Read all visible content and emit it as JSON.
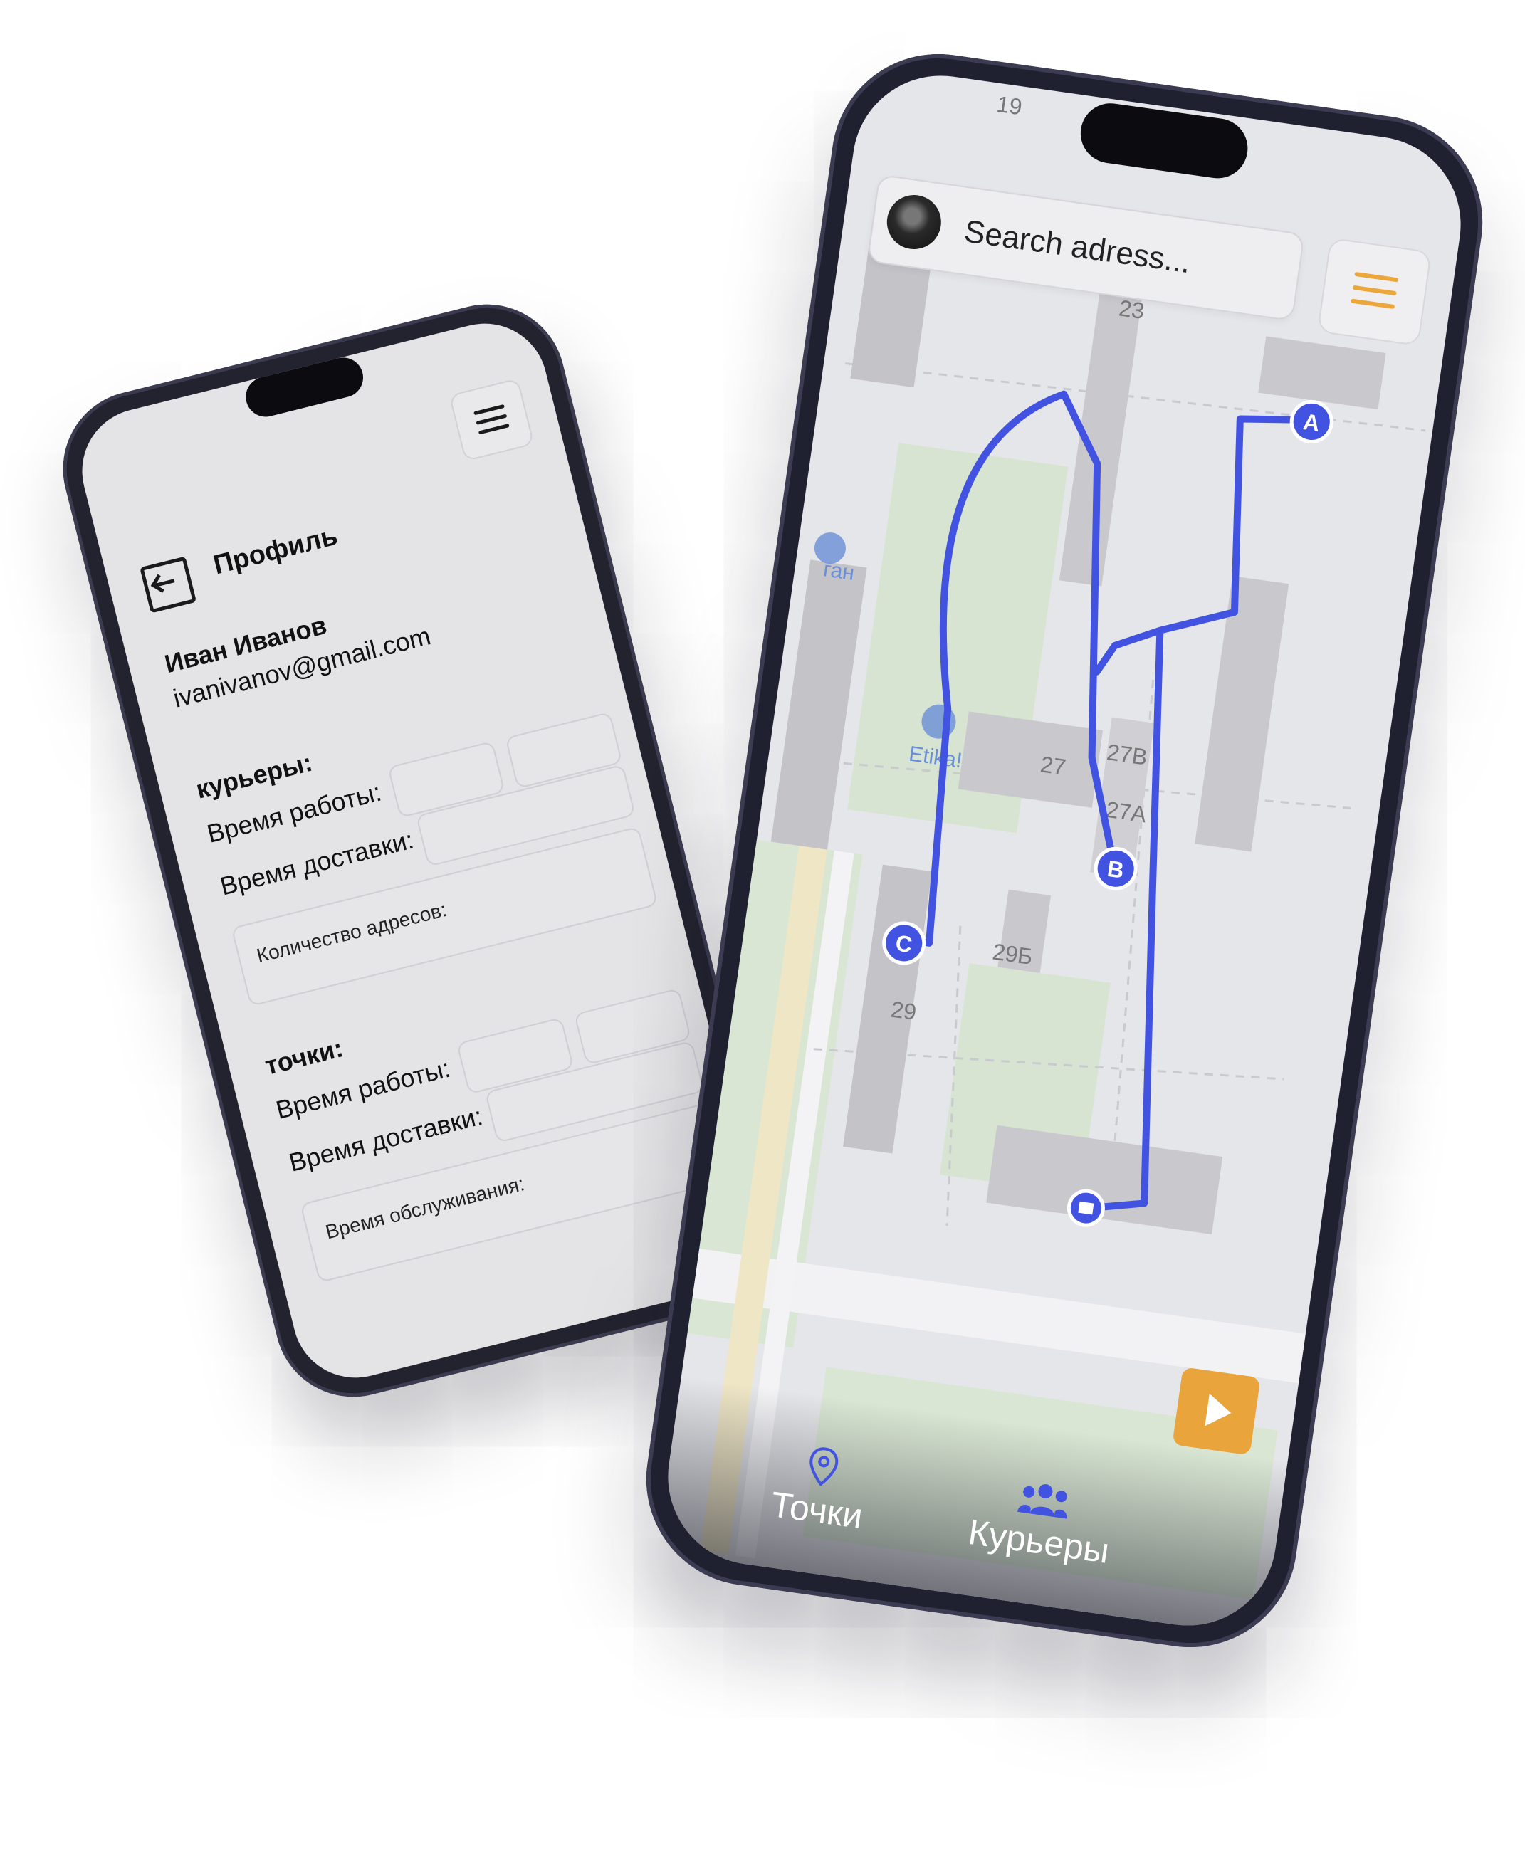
{
  "profile_screen": {
    "title": "Профиль",
    "user": {
      "name": "Иван Иванов",
      "email": "ivanivanov@gmail.com"
    },
    "couriers_section": {
      "heading": "курьеры:",
      "work_time_label": "Время работы:",
      "delivery_time_label": "Время доставки:",
      "address_count_label": "Количество адресов:"
    },
    "points_section": {
      "heading": "точки:",
      "work_time_label": "Время работы:",
      "delivery_time_label": "Время доставки:",
      "service_time_label": "Время обслуживания:"
    }
  },
  "map_screen": {
    "search": {
      "placeholder": "Search adress..."
    },
    "buildings": [
      "19",
      "23",
      "27",
      "27В",
      "27А",
      "29Б",
      "29"
    ],
    "poi": [
      "Etika!",
      "ган"
    ],
    "markers": [
      "A",
      "B",
      "C"
    ],
    "route_color": "#4153e0",
    "accent_color": "#e9a43c",
    "bottom_nav": [
      {
        "label": "Точки",
        "icon": "map-pin-icon"
      },
      {
        "label": "Курьеры",
        "icon": "people-icon"
      }
    ]
  }
}
